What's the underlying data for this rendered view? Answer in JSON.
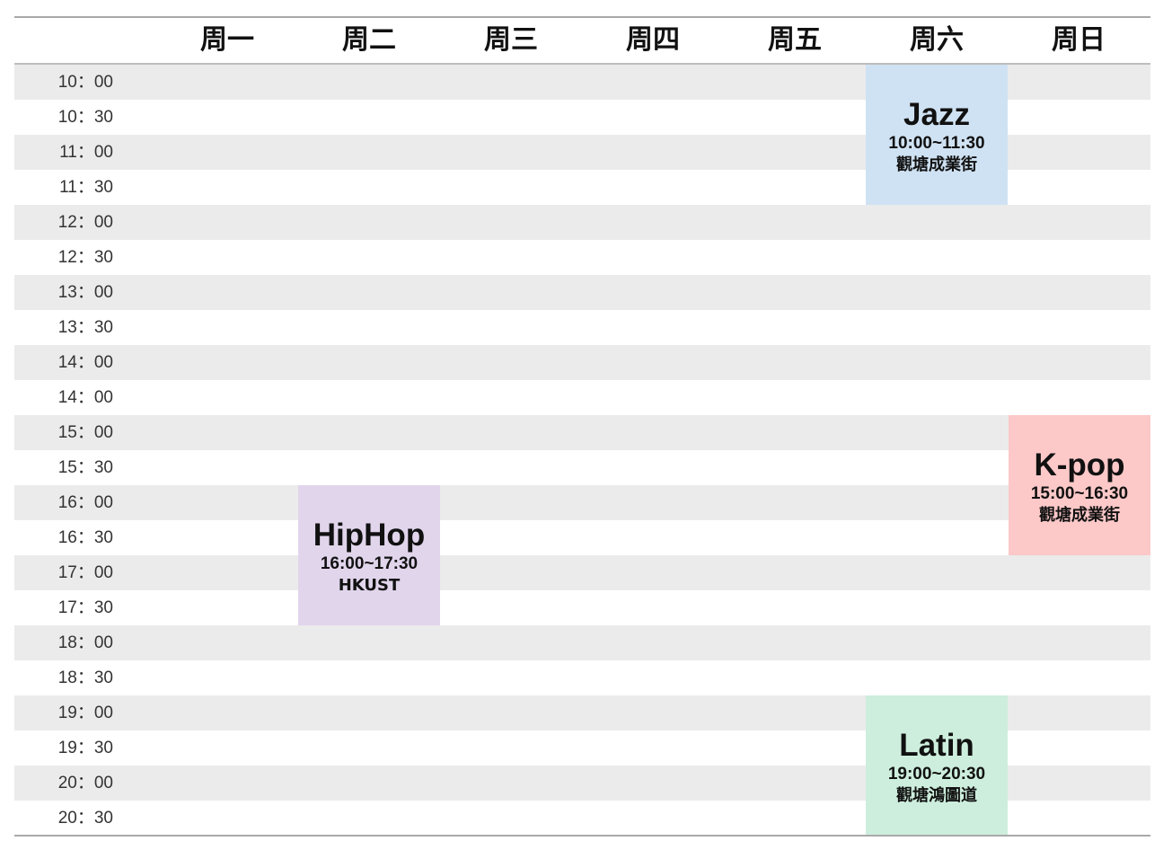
{
  "days": [
    "周一",
    "周二",
    "周三",
    "周四",
    "周五",
    "周六",
    "周日"
  ],
  "times": [
    "10：00",
    "10：30",
    "11：00",
    "11：30",
    "12：00",
    "12：30",
    "13：00",
    "13：30",
    "14：00",
    "14：00",
    "15：00",
    "15：30",
    "16：00",
    "16：30",
    "17：00",
    "17：30",
    "18：00",
    "18：30",
    "19：00",
    "19：30",
    "20：00",
    "20：30"
  ],
  "events": {
    "jazz": {
      "title": "Jazz",
      "time": "10:00~11:30",
      "place": "觀塘成業街",
      "day": "周六",
      "color": "#cfe2f3"
    },
    "kpop": {
      "title": "K-pop",
      "time": "15:00~16:30",
      "place": "觀塘成業街",
      "day": "周日",
      "color": "#fcc8c8"
    },
    "hiphop": {
      "title": "HipHop",
      "time": "16:00~17:30",
      "place": "HKUST",
      "day": "周二",
      "color": "#e1d5ec"
    },
    "latin": {
      "title": "Latin",
      "time": "19:00~20:30",
      "place": "觀塘鴻圖道",
      "day": "周六",
      "color": "#cdeedd"
    }
  },
  "colors": {
    "row_shade": "#ebebeb",
    "rule": "#a9a9a9"
  }
}
